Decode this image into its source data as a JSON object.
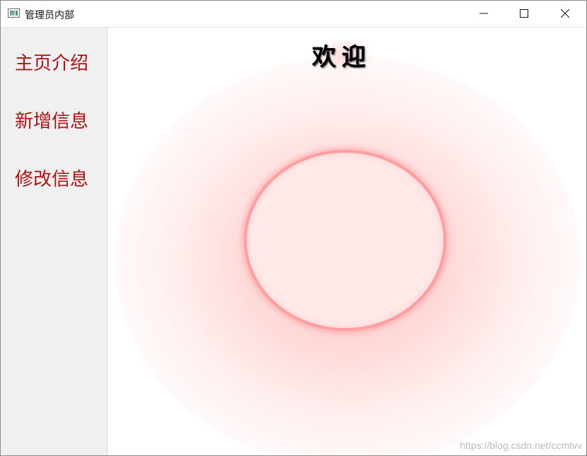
{
  "window": {
    "title": "管理员内部",
    "controls": {
      "minimize": "minimize-icon",
      "maximize": "maximize-icon",
      "close": "close-icon"
    }
  },
  "sidebar": {
    "items": [
      {
        "label": "主页介绍"
      },
      {
        "label": "新增信息"
      },
      {
        "label": "修改信息"
      }
    ]
  },
  "content": {
    "heading": "欢迎",
    "watermark": "https://blog.csdn.net/ccmtvv"
  },
  "colors": {
    "nav_text": "#b01010",
    "glow": "#ffa0a0",
    "sidebar_bg": "#f0f0f0"
  }
}
